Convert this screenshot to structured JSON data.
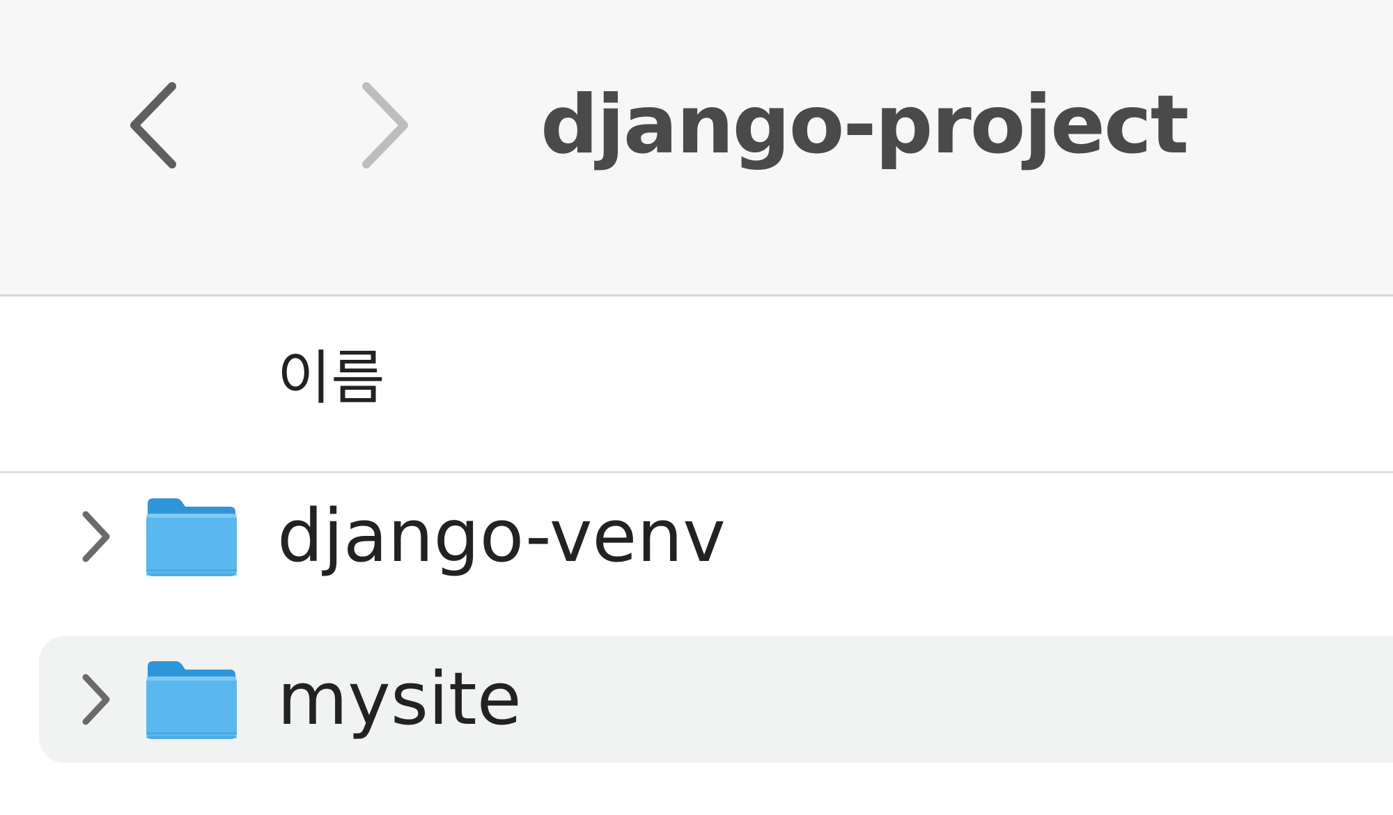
{
  "toolbar": {
    "title": "django-project",
    "back_icon": "chevron-left-icon",
    "forward_icon": "chevron-right-icon"
  },
  "columns": {
    "name_header": "이름"
  },
  "rows": [
    {
      "name": "django-venv",
      "kind": "folder",
      "expanded": false,
      "selected": false
    },
    {
      "name": "mysite",
      "kind": "folder",
      "expanded": false,
      "selected": true
    }
  ],
  "colors": {
    "toolbar_bg": "#f7f7f7",
    "selection_bg": "#f1f3f2",
    "folder_blue": "#5ab8ee",
    "text": "#222222"
  }
}
